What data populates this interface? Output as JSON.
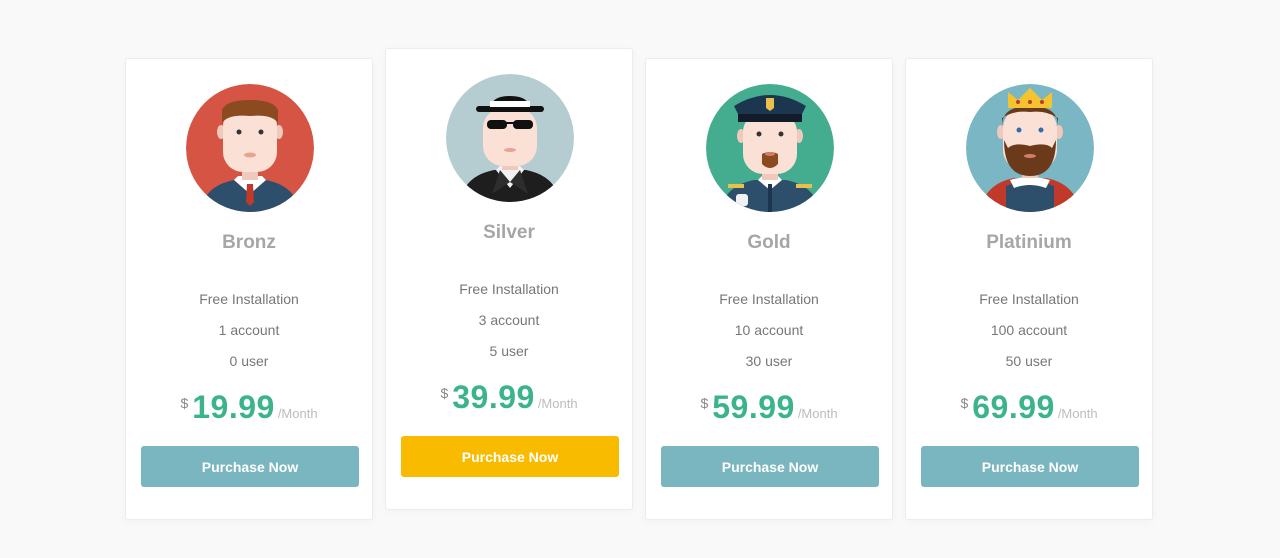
{
  "currency_symbol": "$",
  "period_label": "/Month",
  "plans": [
    {
      "name": "Bronz",
      "avatar": "businessman-avatar",
      "avatar_bg": "#d65443",
      "features": [
        "Free Installation",
        "1 account",
        "0 user"
      ],
      "price": "19.99",
      "button_label": "Purchase Now",
      "button_color": "#7ab6bf",
      "featured": false
    },
    {
      "name": "Silver",
      "avatar": "spy-avatar",
      "avatar_bg": "#b5cdd1",
      "features": [
        "Free Installation",
        "3 account",
        "5 user"
      ],
      "price": "39.99",
      "button_label": "Purchase Now",
      "button_color": "#f9bb00",
      "featured": true
    },
    {
      "name": "Gold",
      "avatar": "captain-avatar",
      "avatar_bg": "#45ad8f",
      "features": [
        "Free Installation",
        "10 account",
        "30 user"
      ],
      "price": "59.99",
      "button_label": "Purchase Now",
      "button_color": "#7ab6bf",
      "featured": false
    },
    {
      "name": "Platinium",
      "avatar": "king-avatar",
      "avatar_bg": "#7ab6c4",
      "features": [
        "Free Installation",
        "100 account",
        "50 user"
      ],
      "price": "69.99",
      "button_label": "Purchase Now",
      "button_color": "#7ab6bf",
      "featured": false
    }
  ],
  "colors": {
    "accent_price": "#3bb48b",
    "button_default": "#7ab6bf",
    "button_featured": "#f9bb00",
    "title_gray": "#a6a6a6"
  }
}
